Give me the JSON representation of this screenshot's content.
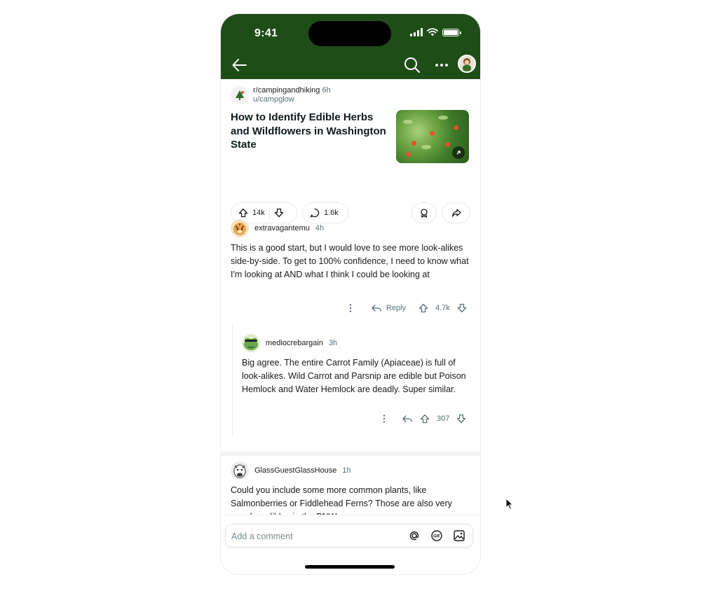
{
  "status_bar": {
    "time": "9:41",
    "battery_level": 1.0
  },
  "nav": {
    "back_icon": "arrow-left-icon",
    "search_icon": "search-icon",
    "more_icon": "ellipsis-icon",
    "avatar": "user-avatar"
  },
  "post": {
    "subreddit": "r/campingandhiking",
    "age": "6h",
    "author": "u/campglow",
    "title": "How to Identify Edible Herbs and Wildflowers in Washington State",
    "upvotes": "14k",
    "comments": "1.6k"
  },
  "comments": [
    {
      "author": "extravagantemu",
      "age": "4h",
      "body": "This is a good start, but I would love to see more look-alikes side-by-side. To get to 100% confidence, I need to know what I'm looking at AND what I think I could be looking at",
      "reply_label": "Reply",
      "score": "4.7k"
    },
    {
      "author": "mediocrebargain",
      "age": "3h",
      "body": "Big agree. The entire Carrot Family (Apiaceae) is full of look-alikes. Wild Carrot and Parsnip are edible but Poison Hemlock and Water Hemlock are deadly. Super similar.",
      "score": "307"
    },
    {
      "author": "GlassGuestGlassHouse",
      "age": "1h",
      "body": "Could you include some more common plants, like Salmonberries or Fiddlehead Ferns? Those are also very popular edibles in the PNW."
    }
  ],
  "composer": {
    "placeholder": "Add a comment"
  },
  "colors": {
    "header_bg": "#1f4d18",
    "text": "#1a1a1b",
    "muted": "#576f76"
  }
}
